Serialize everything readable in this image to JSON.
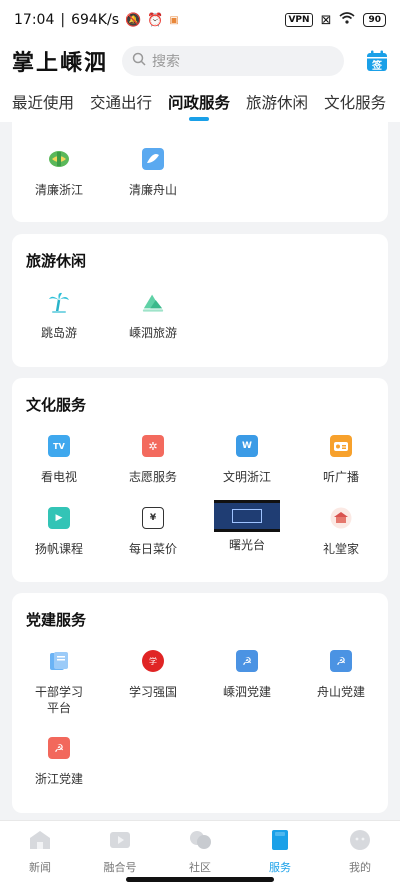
{
  "status": {
    "time": "17:04",
    "speed": "694K/s",
    "vpn": "VPN",
    "battery": "90"
  },
  "header": {
    "logo": "掌上嵊泗",
    "search_placeholder": "搜索",
    "calendar_label": "签"
  },
  "tabs": [
    {
      "label": "最近使用"
    },
    {
      "label": "交通出行"
    },
    {
      "label": "问政服务",
      "active": true
    },
    {
      "label": "旅游休闲"
    },
    {
      "label": "文化服务"
    }
  ],
  "cards": {
    "top": {
      "items": [
        {
          "label": "清廉浙江"
        },
        {
          "label": "清廉舟山"
        }
      ]
    },
    "travel": {
      "title": "旅游休闲",
      "items": [
        {
          "label": "跳岛游"
        },
        {
          "label": "嵊泗旅游"
        }
      ]
    },
    "culture": {
      "title": "文化服务",
      "items": [
        {
          "label": "看电视"
        },
        {
          "label": "志愿服务"
        },
        {
          "label": "文明浙江"
        },
        {
          "label": "听广播"
        },
        {
          "label": "扬帆课程"
        },
        {
          "label": "每日菜价"
        },
        {
          "label": "曙光台"
        },
        {
          "label": "礼堂家"
        }
      ]
    },
    "party": {
      "title": "党建服务",
      "items": [
        {
          "label": "干部学习\n平台"
        },
        {
          "label": "学习强国"
        },
        {
          "label": "嵊泗党建"
        },
        {
          "label": "舟山党建"
        },
        {
          "label": "浙江党建"
        }
      ]
    }
  },
  "bottom_nav": [
    {
      "label": "新闻"
    },
    {
      "label": "融合号"
    },
    {
      "label": "社区"
    },
    {
      "label": "服务",
      "active": true
    },
    {
      "label": "我的"
    }
  ],
  "colors": {
    "accent": "#1aa0e8"
  }
}
